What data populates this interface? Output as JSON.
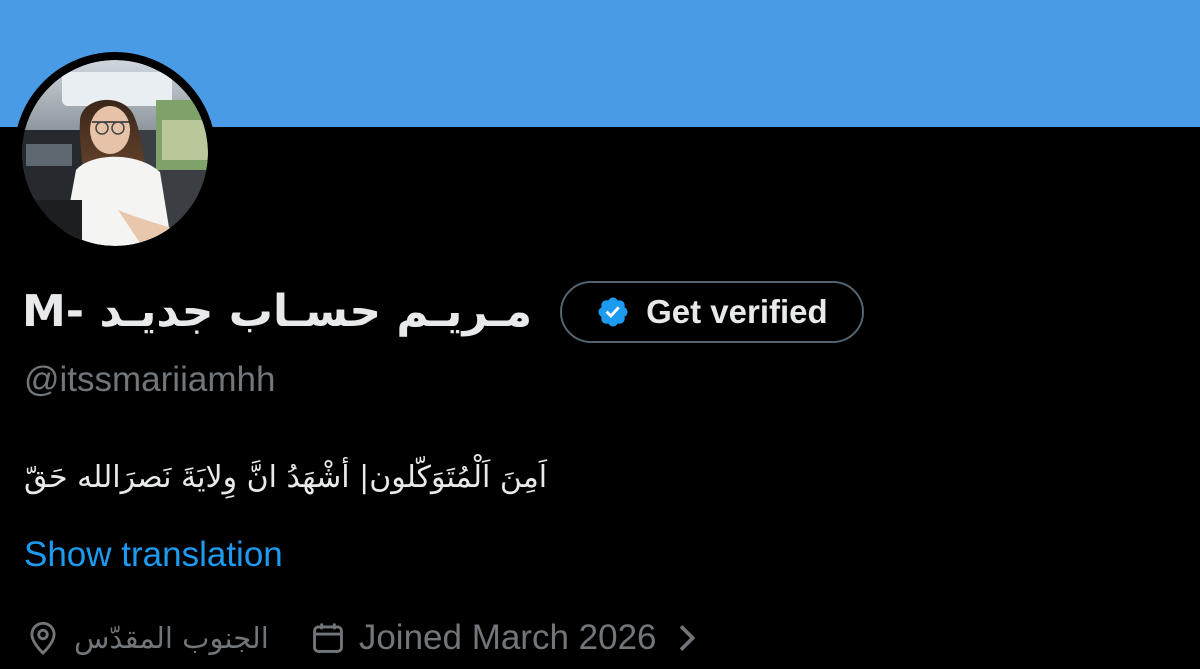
{
  "colors": {
    "banner": "#4a9be6",
    "background": "#000000",
    "text_primary": "#e7e9ea",
    "text_secondary": "#71767b",
    "link": "#1d9bf0",
    "verified_badge": "#1d9bf0",
    "button_border": "#536471"
  },
  "profile": {
    "display_name": "مـريـم حسـاب جديـد -M",
    "handle": "@itssmariiamhh",
    "bio": "اَمِنَ اَلْمُتَوَكّلون| أشْهَدُ انَّ وِلايَةَ نَصرَالله حَقّ",
    "show_translation": "Show translation",
    "location": "الجنوب المقدّس",
    "joined": "Joined March 2026"
  },
  "actions": {
    "get_verified": "Get verified"
  },
  "icons": {
    "verified": "verified-badge-icon",
    "location": "location-pin-icon",
    "calendar": "calendar-icon",
    "chevron": "chevron-right-icon"
  }
}
